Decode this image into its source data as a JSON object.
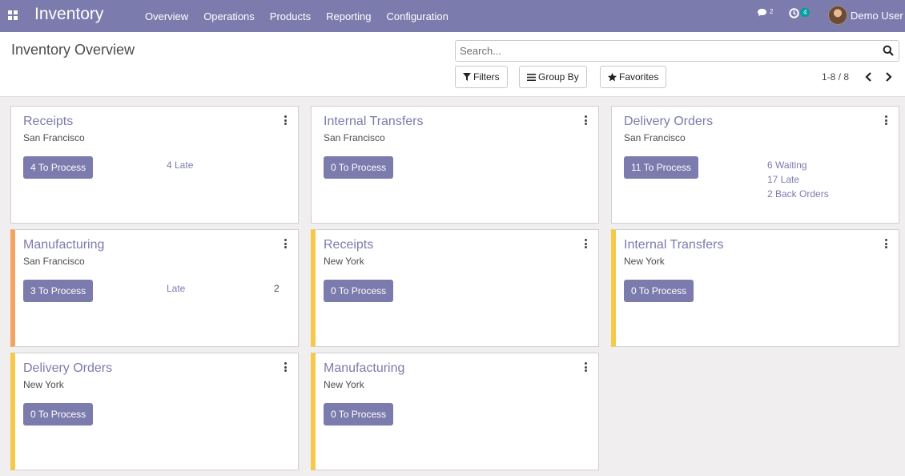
{
  "navbar": {
    "brand": "Inventory",
    "menu": [
      "Overview",
      "Operations",
      "Products",
      "Reporting",
      "Configuration"
    ],
    "chat_count": "2",
    "activity_count": "4",
    "user_name": "Demo User"
  },
  "control_panel": {
    "title": "Inventory Overview",
    "search_placeholder": "Search...",
    "filters_label": "Filters",
    "group_by_label": "Group By",
    "favorites_label": "Favorites",
    "pager": "1-8 / 8"
  },
  "cards": [
    {
      "title": "Receipts",
      "location": "San Francisco",
      "button": "4 To Process",
      "links": [
        "4 Late"
      ],
      "accent": "none"
    },
    {
      "title": "Internal Transfers",
      "location": "San Francisco",
      "button": "0 To Process",
      "links": [],
      "accent": "none"
    },
    {
      "title": "Delivery Orders",
      "location": "San Francisco",
      "button": "11 To Process",
      "links": [
        "6 Waiting",
        "17 Late",
        "2 Back Orders"
      ],
      "accent": "none"
    },
    {
      "title": "Manufacturing",
      "location": "San Francisco",
      "button": "3 To Process",
      "links": [
        "Late"
      ],
      "count": "2",
      "accent": "orange"
    },
    {
      "title": "Receipts",
      "location": "New York",
      "button": "0 To Process",
      "links": [],
      "accent": "yellow"
    },
    {
      "title": "Internal Transfers",
      "location": "New York",
      "button": "0 To Process",
      "links": [],
      "accent": "yellow"
    },
    {
      "title": "Delivery Orders",
      "location": "New York",
      "button": "0 To Process",
      "links": [],
      "accent": "yellow"
    },
    {
      "title": "Manufacturing",
      "location": "New York",
      "button": "0 To Process",
      "links": [],
      "accent": "yellow"
    }
  ],
  "colors": {
    "navbar": "#7c7bad",
    "primary": "#7c7bad",
    "accent_orange": "#f4a460",
    "accent_yellow": "#f7c948",
    "badge_green": "#00a09d"
  }
}
